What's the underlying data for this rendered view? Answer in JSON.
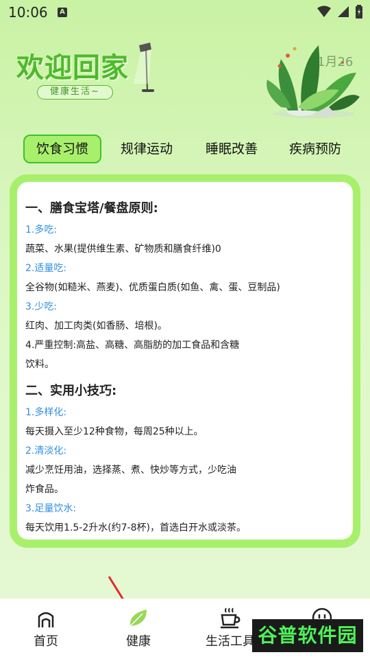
{
  "status": {
    "time": "10:06",
    "a_icon": "A"
  },
  "header": {
    "title": "欢迎回家",
    "subtitle": "健康生活~",
    "date": "1月26"
  },
  "tabs": [
    {
      "label": "饮食习惯",
      "active": true
    },
    {
      "label": "规律运动",
      "active": false
    },
    {
      "label": "睡眠改善",
      "active": false
    },
    {
      "label": "疾病预防",
      "active": false
    }
  ],
  "content": {
    "section1_title": "一、膳食宝塔/餐盘原则:",
    "l1": "1.多吃:",
    "l2": "蔬菜、水果(提供维生素、矿物质和膳食纤维)0",
    "l3": "2.适量吃:",
    "l4": "全谷物(如糙米、燕麦)、优质蛋白质(如鱼、禽、蛋、豆制品)",
    "l5": "3.少吃:",
    "l6": "红肉、加工肉类(如香肠、培根)。",
    "l7": "4.严重控制:高盐、高糖、高脂肪的加工食品和含糖",
    "l8": "饮料。",
    "section2_title": "二、实用小技巧:",
    "m1": "1.多样化:",
    "m2": "每天摄入至少12种食物，每周25种以上。",
    "m3": "2.清淡化:",
    "m4": "减少烹饪用油，选择蒸、煮、快炒等方式，少吃油",
    "m5": "炸食品。",
    "m6": "3.足量饮水:",
    "m7": "每天饮用1.5-2升水(约7-8杯)，首选白开水或淡茶。"
  },
  "nav": [
    {
      "label": "首页",
      "icon": "home-icon"
    },
    {
      "label": "健康",
      "icon": "leaf-icon"
    },
    {
      "label": "生活工具",
      "icon": "coffee-icon"
    },
    {
      "label": "",
      "icon": "smiley-icon"
    }
  ],
  "watermark": "谷普软件园",
  "colors": {
    "accent": "#a8f06c",
    "accent_border": "#3fbf2c",
    "link_blue": "#2e8fe0",
    "title_green": "#4fb92d"
  }
}
